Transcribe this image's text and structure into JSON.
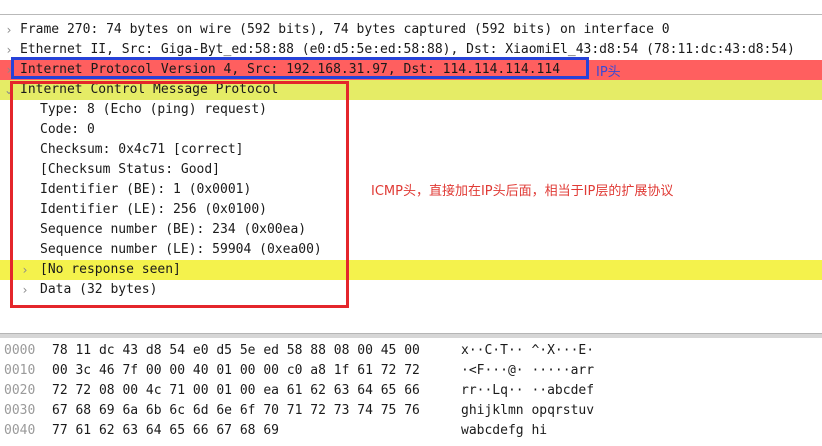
{
  "tree": {
    "frame": "Frame 270: 74 bytes on wire (592 bits), 74 bytes captured (592 bits) on interface 0",
    "ethernet": "Ethernet II, Src: Giga-Byt_ed:58:88 (e0:d5:5e:ed:58:88), Dst: XiaomiEl_43:d8:54 (78:11:dc:43:d8:54)",
    "ip": "Internet Protocol Version 4, Src: 192.168.31.97, Dst: 114.114.114.114",
    "icmp": "Internet Control Message Protocol",
    "fields": [
      "Type: 8 (Echo (ping) request)",
      "Code: 0",
      "Checksum: 0x4c71 [correct]",
      "[Checksum Status: Good]",
      "Identifier (BE): 1 (0x0001)",
      "Identifier (LE): 256 (0x0100)",
      "Sequence number (BE): 234 (0x00ea)",
      "Sequence number (LE): 59904 (0xea00)"
    ],
    "no_response": "[No response seen]",
    "data": "Data (32 bytes)"
  },
  "annotations": {
    "ip_label": "IP头",
    "icmp_label": "ICMP头，直接加在IP头后面，相当于IP层的扩展协议"
  },
  "hex": [
    {
      "offset": "0000",
      "bytes": "78 11 dc 43 d8 54 e0 d5  5e ed 58 88 08 00 45 00",
      "ascii": "x··C·T·· ^·X···E·"
    },
    {
      "offset": "0010",
      "bytes": "00 3c 46 7f 00 00 40 01  00 00 c0 a8 1f 61 72 72",
      "ascii": "·<F···@· ·····arr"
    },
    {
      "offset": "0020",
      "bytes": "72 72 08 00 4c 71 00 01  00 ea 61 62 63 64 65 66",
      "ascii": "rr··Lq·· ··abcdef"
    },
    {
      "offset": "0030",
      "bytes": "67 68 69 6a 6b 6c 6d 6e  6f 70 71 72 73 74 75 76",
      "ascii": "ghijklmn opqrstuv"
    },
    {
      "offset": "0040",
      "bytes": "77 61 62 63 64 65 66 67  68 69",
      "ascii": "wabcdefg hi"
    }
  ],
  "colors": {
    "ip_highlight": "#ff5f5f",
    "icmp_highlight": "#e5ec66",
    "selected_highlight": "#f4f24c",
    "blue_annotation": "#2742d8",
    "red_annotation": "#e4262b"
  },
  "icons": {
    "collapsed": "chevron-right-icon",
    "expanded": "chevron-down-icon"
  }
}
